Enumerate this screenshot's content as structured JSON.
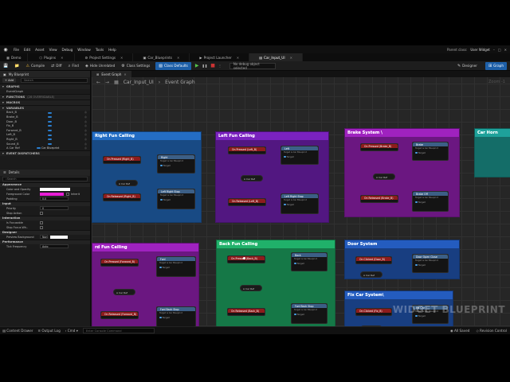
{
  "menu": {
    "items": [
      "File",
      "Edit",
      "Asset",
      "View",
      "Debug",
      "Window",
      "Tools",
      "Help"
    ],
    "parent_label": "Parent class:",
    "parent_value": "User Widget"
  },
  "tabs": [
    {
      "label": "Demo",
      "icon": "level-icon"
    },
    {
      "label": "Plugins",
      "icon": "plugin-icon"
    },
    {
      "label": "Project Settings",
      "icon": "gear-icon"
    },
    {
      "label": "Car_Blueprints",
      "icon": "blueprint-icon"
    },
    {
      "label": "Project Launcher",
      "icon": "launch-icon"
    },
    {
      "label": "Car_Input_UI",
      "icon": "widget-icon",
      "active": true
    }
  ],
  "toolbar": {
    "compile": "Compile",
    "diff": "Diff",
    "find": "Find",
    "hide_unrelated": "Hide Unrelated",
    "class_settings": "Class Settings",
    "class_defaults": "Class Defaults",
    "debug_dropdown": "No debug object selected",
    "designer": "Designer",
    "graph": "Graph"
  },
  "my_blueprint": {
    "title": "My Blueprint",
    "add": "+ Add",
    "search_placeholder": "Search",
    "sections": {
      "graphs": "GRAPHS",
      "event_graph": "EventGraph",
      "functions": "FUNCTIONS",
      "functions_count": "(28 OVERRIDABLE)",
      "macros": "MACROS",
      "variables": "VARIABLES",
      "event_dispatchers": "EVENT DISPATCHERS"
    },
    "variables": [
      {
        "name": "Back_B"
      },
      {
        "name": "Brake_B"
      },
      {
        "name": "Door_B"
      },
      {
        "name": "Fix_B"
      },
      {
        "name": "Forward_B"
      },
      {
        "name": "Left_B"
      },
      {
        "name": "Right_B"
      },
      {
        "name": "Sound_B"
      },
      {
        "name": "A Car Ref",
        "type": "Car Blueprint"
      }
    ]
  },
  "details": {
    "title": "Details",
    "search_placeholder": "Search",
    "appearance": "Appearance",
    "color_opacity": "Color and Opacity",
    "foreground_color": "Foreground Color",
    "inherit": "Inherit",
    "padding": "Padding",
    "padding_val": "0.0",
    "input": "Input",
    "priority": "Priority",
    "priority_val": "0",
    "stop_action": "Stop Action",
    "interaction": "Interaction",
    "is_focusable": "Is Focusable",
    "stop_focus": "Stop Focus Wh..",
    "designer": "Designer",
    "preview_background": "Preview Background",
    "preview_val": "Non",
    "performance": "Performance",
    "tick_frequency": "Tick Frequency",
    "tick_val": "Auto"
  },
  "graph": {
    "tab": "Event Graph",
    "breadcrumb_bp": "Car_Input_UI",
    "breadcrumb_graph": "Event Graph",
    "zoom": "Zoom -1",
    "watermark": "WIDGET BLUEPRINT"
  },
  "comments": [
    {
      "id": "right",
      "title": "Right Fun Calling",
      "color": "#1f5faa"
    },
    {
      "id": "left",
      "title": "Left Fun Calling",
      "color": "#6a1ea6"
    },
    {
      "id": "brake",
      "title": "Brake System \\",
      "color": "#8a1ea6"
    },
    {
      "id": "horn",
      "title": "Car Horn",
      "color": "#1a8c86"
    },
    {
      "id": "forward",
      "title": "rd Fun Calling",
      "color": "#8a1ea6"
    },
    {
      "id": "back",
      "title": "Back Fun Calling",
      "color": "#1c9a5c"
    },
    {
      "id": "door",
      "title": "Door System",
      "color": "#1f50a6"
    },
    {
      "id": "fix",
      "title": "Fix Car System\\",
      "color": "#1f50a6"
    }
  ],
  "nodes": {
    "right_pressed": "On Pressed (Right_B)",
    "right_fn": "Right",
    "right_rel": "On Released (Right_B)",
    "right_stop": "Left Right Stop",
    "left_pressed": "On Pressed (Left_B)",
    "left_fn": "Left",
    "left_rel": "On Released (Left_B)",
    "left_stop": "Left Right Stop",
    "brake_pressed": "On Pressed (Brake_B)",
    "brake_fn": "Brake",
    "brake_rel": "On Released (Brake_B)",
    "brake_stop": "Brake Off",
    "fwd_pressed": "On Pressed (Forward_B)",
    "fwd_fn": "Fwd",
    "fwd_rel": "On Released (Forward_B)",
    "fwd_stop": "Fwd Back Stop",
    "back_pressed": "On Pressed (Back_B)",
    "back_fn": "Back",
    "back_rel": "On Released (Back_B)",
    "back_stop": "Fwd Back Stop",
    "door_rel": "On Clicked (Door_B)",
    "door_fn": "Door Open Close",
    "fix_rel": "On Clicked (Fix_B)",
    "fix_fn": "Fix Car",
    "car_ref": "A Car Ref",
    "target": "Target",
    "sub": "Target is Car Blueprint"
  },
  "status": {
    "content_drawer": "Content Drawer",
    "output_log": "Output Log",
    "cmd": "Cmd",
    "cmd_placeholder": "Enter Console Command",
    "all_saved": "All Saved",
    "revision": "Revision Control"
  }
}
